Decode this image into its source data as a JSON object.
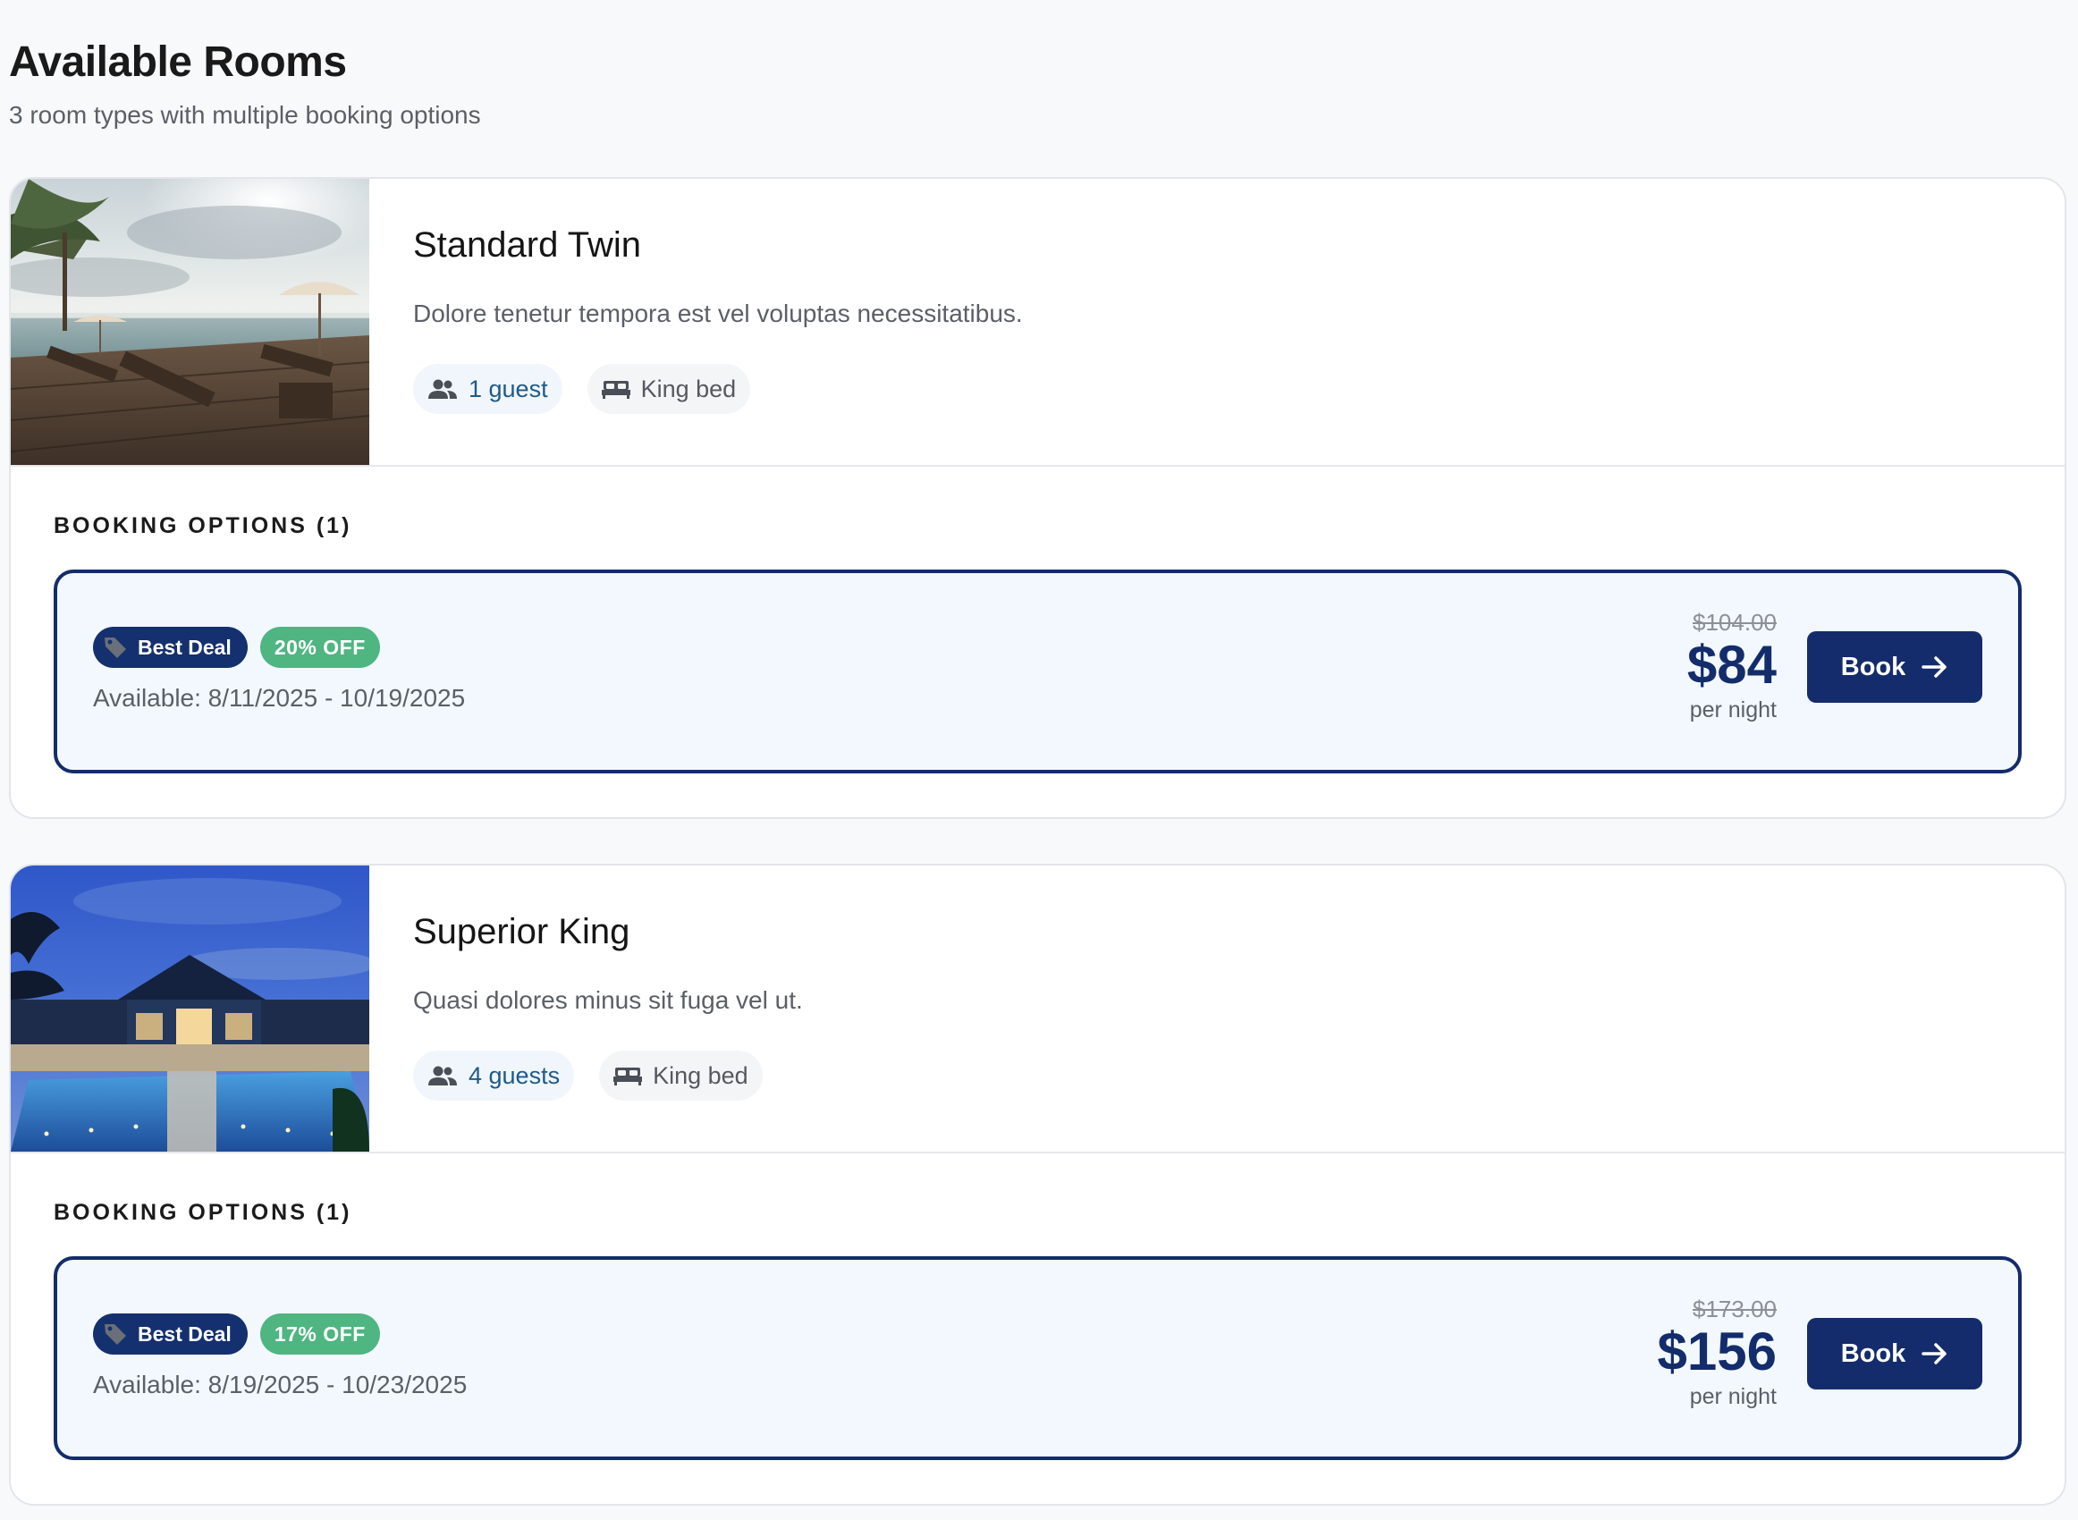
{
  "page": {
    "title": "Available Rooms",
    "subtitle": "3 room types with multiple booking options"
  },
  "rooms": [
    {
      "name": "Standard Twin",
      "description": "Dolore tenetur tempora est vel voluptas necessitatibus.",
      "guests_label": "1 guest",
      "bed_label": "King bed",
      "photo_icon": "beach-deck-photo",
      "options_heading": "BOOKING OPTIONS (1)",
      "options": [
        {
          "badge_label": "Best Deal",
          "discount_label": "20% OFF",
          "availability": "Available: 8/11/2025 - 10/19/2025",
          "old_price": "$104.00",
          "price": "$84",
          "price_unit": "per night",
          "book_label": "Book"
        }
      ]
    },
    {
      "name": "Superior King",
      "description": "Quasi dolores minus sit fuga vel ut.",
      "guests_label": "4 guests",
      "bed_label": "King bed",
      "photo_icon": "night-pool-photo",
      "options_heading": "BOOKING OPTIONS (1)",
      "options": [
        {
          "badge_label": "Best Deal",
          "discount_label": "17% OFF",
          "availability": "Available: 8/19/2025 - 10/23/2025",
          "old_price": "$173.00",
          "price": "$156",
          "price_unit": "per night",
          "book_label": "Book"
        }
      ]
    }
  ],
  "colors": {
    "brand": "#142c6b",
    "discount": "#4fb581",
    "option_bg": "#f2f8fe",
    "page_bg": "#f8f9fb"
  }
}
